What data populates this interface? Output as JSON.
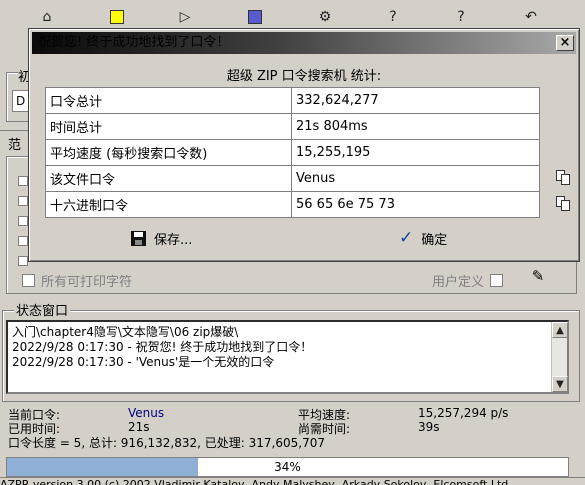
{
  "dialog": {
    "title": "祝贺您! 终于成功地找到了口令！",
    "close_label": "×",
    "heading": "超级 ZIP 口令搜索机 统计:",
    "rows": [
      {
        "label": "口令总计",
        "value": "332,624,277"
      },
      {
        "label": "时间总计",
        "value": "21s 804ms"
      },
      {
        "label": "平均速度 (每秒搜索口令数)",
        "value": "15,255,195"
      },
      {
        "label": "该文件口令",
        "value": "Venus"
      },
      {
        "label": "十六进制口令",
        "value": "56 65 6e 75 73"
      }
    ],
    "save_label": "保存...",
    "ok_label": "确定"
  },
  "main": {
    "left_fragments": [
      "初",
      "D",
      "范"
    ],
    "printable_label": "所有可打印字符",
    "user_defined_label": "用户定义",
    "status_group_title": "状态窗口",
    "log_lines": [
      "入门\\chapter4隐写\\文本隐写\\06 zip爆破\\",
      "2022/9/28 0:17:30 - 祝贺您! 终于成功地找到了口令！",
      "2022/9/28 0:17:30 - 'Venus'是一个无效的口令"
    ],
    "current_password_label": "当前口令:",
    "current_password_value": "Venus",
    "avg_speed_label": "平均速度:",
    "avg_speed_value": "15,257,294 p/s",
    "elapsed_label": "已用时间:",
    "elapsed_value": "21s",
    "remaining_label": "尚需时间:",
    "remaining_value": "39s",
    "length_line": "口令长度 = 5, 总计: 916,132,832, 已处理: 317,605,707",
    "progress_percent": 34,
    "progress_text": "34%",
    "status_bar": "AZPR version 3.00 (c) 2002 Vladimir Katalov, Andy Malyshev, Arkady Sokolov, Elcomsoft Ltd"
  },
  "colors": {
    "progress_fill": "#8fafd6",
    "value_blue": "#000080",
    "ok_check": "#1f3fa8"
  },
  "icons": [
    "open-icon",
    "save-icon",
    "play-icon",
    "stop-icon",
    "settings-icon",
    "help-icon",
    "about-icon",
    "exit-icon",
    "floppy-icon",
    "checkmark-icon",
    "copy-icon"
  ]
}
